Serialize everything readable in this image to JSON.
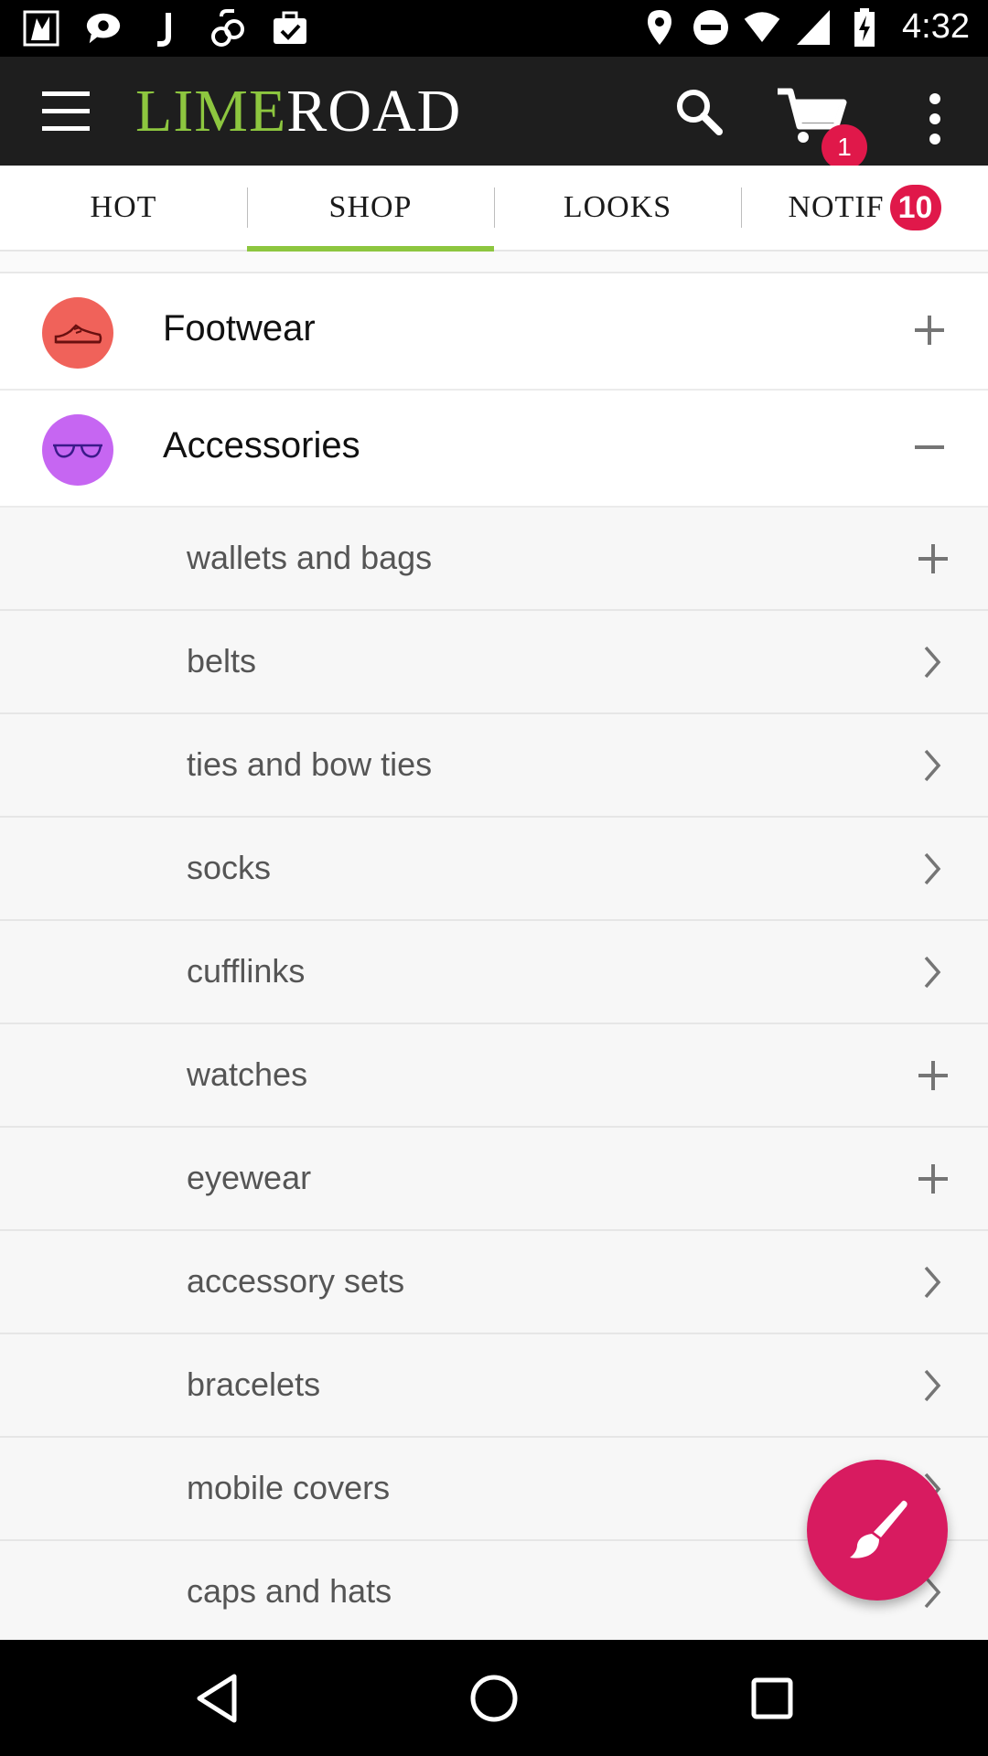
{
  "status_bar": {
    "time": "4:32",
    "left_icons": [
      "photo-app-icon",
      "chat-bubble-icon",
      "j-app-icon",
      "link-icon",
      "briefcase-check-icon"
    ],
    "right_icons": [
      "location-icon",
      "do-not-disturb-icon",
      "wifi-icon",
      "cell-signal-icon",
      "battery-charging-icon"
    ]
  },
  "app_bar": {
    "logo_part1": "LIME",
    "logo_part2": "ROAD",
    "cart_count": "1",
    "colors": {
      "background": "#1e1e1e",
      "lime": "#8dc63f",
      "badge": "#e0184a"
    }
  },
  "tabs": [
    {
      "label": "HOT"
    },
    {
      "label": "SHOP",
      "active": true
    },
    {
      "label": "LOOKS"
    },
    {
      "label": "NOTIF",
      "badge": "10"
    }
  ],
  "categories": [
    {
      "label": "Footwear",
      "icon": "shoe-icon",
      "icon_bg": "#f0625a",
      "toggle": "plus",
      "expanded": false
    },
    {
      "label": "Accessories",
      "icon": "eyeglasses-icon",
      "icon_bg": "#c666f2",
      "toggle": "minus",
      "expanded": true
    }
  ],
  "subcategories": [
    {
      "label": "wallets and bags",
      "action": "plus"
    },
    {
      "label": "belts",
      "action": "chevron"
    },
    {
      "label": "ties and bow ties",
      "action": "chevron"
    },
    {
      "label": "socks",
      "action": "chevron"
    },
    {
      "label": "cufflinks",
      "action": "chevron"
    },
    {
      "label": "watches",
      "action": "plus"
    },
    {
      "label": "eyewear",
      "action": "plus"
    },
    {
      "label": "accessory sets",
      "action": "chevron"
    },
    {
      "label": "bracelets",
      "action": "chevron"
    },
    {
      "label": "mobile covers",
      "action": "chevron"
    },
    {
      "label": "caps and hats",
      "action": "chevron"
    }
  ],
  "fab": {
    "icon": "paint-brush-icon",
    "color": "#d81b60"
  },
  "nav_bar": {
    "icons": [
      "back-icon",
      "home-icon",
      "recents-icon"
    ]
  }
}
